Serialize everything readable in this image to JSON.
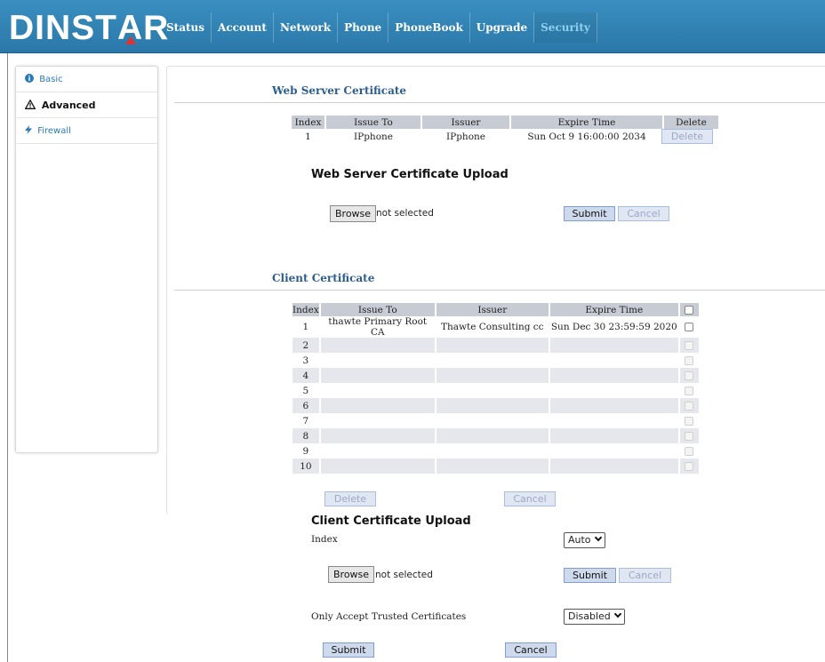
{
  "header": {
    "logo": "DINSTAR",
    "nav": [
      "Status",
      "Account",
      "Network",
      "Phone",
      "PhoneBook",
      "Upgrade",
      "Security"
    ],
    "active": "Security"
  },
  "sidebar": {
    "items": [
      {
        "label": "Basic",
        "icon": "info-circle-icon"
      },
      {
        "label": "Advanced",
        "icon": "warning-triangle-icon"
      },
      {
        "label": "Firewall",
        "icon": "lightning-icon"
      }
    ]
  },
  "web_cert": {
    "title": "Web Server Certificate",
    "columns": [
      "Index",
      "Issue To",
      "Issuer",
      "Expire Time",
      "Delete"
    ],
    "rows": [
      {
        "index": "1",
        "issue_to": "IPphone",
        "issuer": "IPphone",
        "expire": "Sun Oct 9 16:00:00 2034",
        "delete": "Delete"
      }
    ]
  },
  "web_upload": {
    "title": "Web Server Certificate Upload",
    "browse": "Browse",
    "file_status": "not selected",
    "submit": "Submit",
    "cancel": "Cancel"
  },
  "client_cert": {
    "title": "Client Certificate",
    "columns": [
      "Index",
      "Issue To",
      "Issuer",
      "Expire Time"
    ],
    "rows": [
      {
        "index": "1",
        "issue_to": "thawte Primary Root CA",
        "issuer": "Thawte Consulting cc",
        "expire": "Sun Dec 30 23:59:59 2020"
      },
      {
        "index": "2",
        "issue_to": "",
        "issuer": "",
        "expire": ""
      },
      {
        "index": "3",
        "issue_to": "",
        "issuer": "",
        "expire": ""
      },
      {
        "index": "4",
        "issue_to": "",
        "issuer": "",
        "expire": ""
      },
      {
        "index": "5",
        "issue_to": "",
        "issuer": "",
        "expire": ""
      },
      {
        "index": "6",
        "issue_to": "",
        "issuer": "",
        "expire": ""
      },
      {
        "index": "7",
        "issue_to": "",
        "issuer": "",
        "expire": ""
      },
      {
        "index": "8",
        "issue_to": "",
        "issuer": "",
        "expire": ""
      },
      {
        "index": "9",
        "issue_to": "",
        "issuer": "",
        "expire": ""
      },
      {
        "index": "10",
        "issue_to": "",
        "issuer": "",
        "expire": ""
      }
    ],
    "delete": "Delete",
    "cancel": "Cancel"
  },
  "client_upload": {
    "title": "Client Certificate Upload",
    "index_label": "Index",
    "index_value": "Auto",
    "browse": "Browse",
    "file_status": "not selected",
    "submit": "Submit",
    "cancel": "Cancel",
    "trusted_label": "Only Accept Trusted Certificates",
    "trusted_value": "Disabled",
    "final_submit": "Submit",
    "final_cancel": "Cancel"
  }
}
